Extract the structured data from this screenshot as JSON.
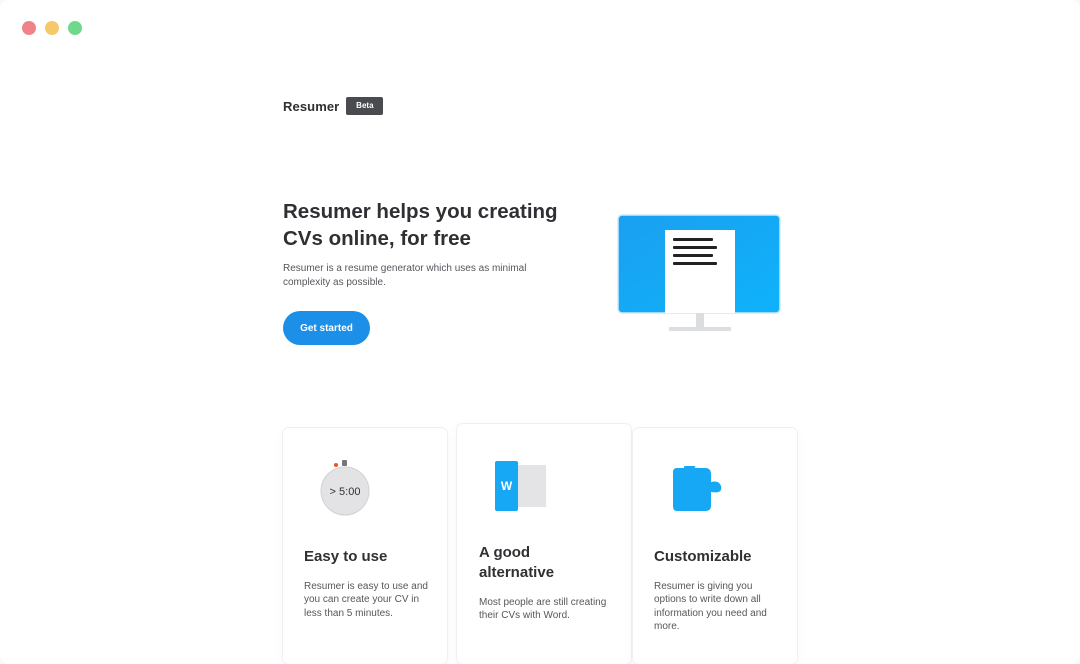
{
  "window": {
    "controls": [
      "close",
      "minimize",
      "maximize"
    ]
  },
  "brand": {
    "name": "Resumer",
    "badge": "Beta"
  },
  "hero": {
    "title_line1": "Resumer helps you creating",
    "title_line2": "CVs online, for free",
    "subtitle": "Resumer is a resume generator which uses as minimal complexity as possible.",
    "cta_label": "Get started",
    "illustration_icon": "monitor-document-icon"
  },
  "features": [
    {
      "icon": "stopwatch-icon",
      "icon_text": "> 5:00",
      "title": "Easy to use",
      "text": "Resumer is easy to use and you can create your CV in less than 5 minutes."
    },
    {
      "icon": "word-document-icon",
      "icon_text": "W",
      "title": "A good alternative",
      "text": "Most people are still creating their CVs with Word."
    },
    {
      "icon": "puzzle-piece-icon",
      "title": "Customizable",
      "text": "Resumer is giving you options to write down all information you need and more."
    }
  ],
  "colors": {
    "accent": "#1c8fe8",
    "icon_blue": "#16a8f5",
    "badge_bg": "#4a4b4f",
    "text_dark": "#2f3033",
    "text_muted": "#55575c"
  }
}
